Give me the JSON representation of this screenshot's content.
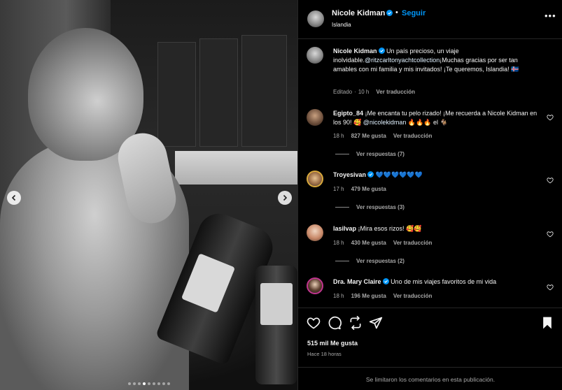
{
  "post": {
    "author": "Nicole Kidman",
    "follow_label": "Seguir",
    "separator": "•",
    "location": "Islandia",
    "more_label": "•••"
  },
  "caption": {
    "author": "Nicole Kidman",
    "text_1": "Un país precioso, un viaje inolvidable.",
    "mention": "@ritzcarltonyachtcollection",
    "text_2": "¡Muchas gracias por ser tan amables con mi familia y mis invitados! ¡Te queremos, Islandia! ",
    "emoji": "🇮🇸",
    "edited": "Editado",
    "dot": "·",
    "time": "10 h",
    "translate": "Ver traducción"
  },
  "comments": [
    {
      "user": "Egipto_84",
      "text_1": "¡Me encanta tu pelo rizado! ¡Me recuerda a Nicole Kidman en los 90! 🥰 ",
      "mention": "@nicolekidman",
      "text_2": " 🔥🔥🔥 el 🐐",
      "time": "18 h",
      "likes": "827 Me gusta",
      "translate": "Ver traducción",
      "replies": "Ver respuestas (7)"
    },
    {
      "user": "Troyesivan",
      "text_1": "💙💙💙💙💙💙",
      "time": "17 h",
      "likes": "479 Me gusta",
      "replies": "Ver respuestas (3)"
    },
    {
      "user": "lasilvap",
      "text_1": "¡Mira esos rizos! 🥰🥰",
      "time": "18 h",
      "likes": "430 Me gusta",
      "translate": "Ver traducción",
      "replies": "Ver respuestas (2)"
    },
    {
      "user": "Dra. Mary Claire",
      "text_1": "Uno de mis viajes favoritos de mi vida",
      "time": "18 h",
      "likes": "196 Me gusta",
      "translate": "Ver traducción"
    }
  ],
  "footer": {
    "likes": "515 mil Me gusta",
    "ago": "Hace 18 horas",
    "limited": "Se limitaron los comentarios en esta publicación."
  },
  "carousel": {
    "slide_count": 9,
    "active_index": 3
  },
  "colors": {
    "background": "#000000",
    "link_blue": "#0095f6",
    "verified_blue": "#0095f6",
    "muted_text": "#a8a8a8",
    "divider": "#262626"
  },
  "icons": [
    "verified-icon",
    "more-icon",
    "heart-icon",
    "comment-icon",
    "share-icon",
    "send-icon",
    "bookmark-icon",
    "chevron-left-icon",
    "chevron-right-icon"
  ]
}
